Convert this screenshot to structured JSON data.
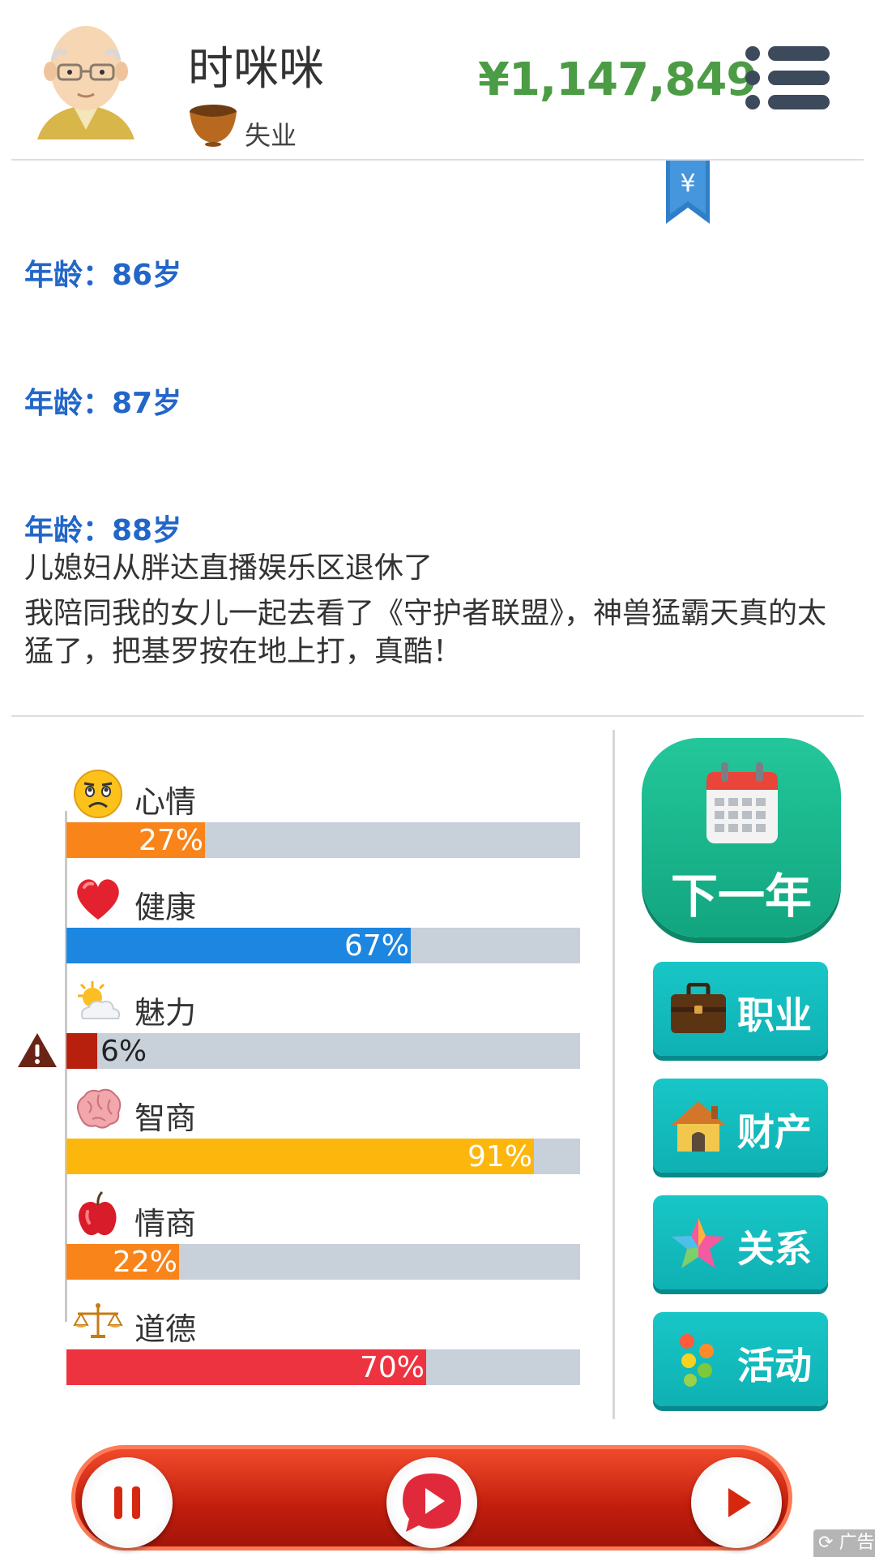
{
  "header": {
    "player_name": "时咪咪",
    "job": "失业",
    "money": "¥1,147,849"
  },
  "log": {
    "ages": [
      "年龄：86岁",
      "年龄：87岁",
      "年龄：88岁"
    ],
    "events": [
      "儿媳妇从胖达直播娱乐区退休了",
      "我陪同我的女儿一起去看了《守护者联盟》，神兽猛霸天真的太猛了，把基罗按在地上打，真酷！"
    ]
  },
  "stats": [
    {
      "label": "心情",
      "icon": "sad-face-icon",
      "value": 27,
      "text": "27%",
      "color": "#f8841a"
    },
    {
      "label": "健康",
      "icon": "heart-icon",
      "value": 67,
      "text": "67%",
      "color": "#1d86e0"
    },
    {
      "label": "魅力",
      "icon": "sun-cloud-icon",
      "value": 6,
      "text": "6%",
      "color": "#b8200e",
      "warning": true
    },
    {
      "label": "智商",
      "icon": "brain-icon",
      "value": 91,
      "text": "91%",
      "color": "#fdb60c"
    },
    {
      "label": "情商",
      "icon": "apple-icon",
      "value": 22,
      "text": "22%",
      "color": "#f8841a"
    },
    {
      "label": "道德",
      "icon": "scales-icon",
      "value": 70,
      "text": "70%",
      "color": "#ee3340"
    }
  ],
  "buttons": {
    "next_year": "下一年",
    "career": "职业",
    "assets": "财产",
    "relations": "关系",
    "activities": "活动"
  },
  "footer": {
    "ad_label": "广告"
  },
  "colors": {
    "money": "#4c9c45",
    "age_text": "#2266c8",
    "teal_button": "#14bcbd",
    "green_button": "#1ab88d",
    "bottom_bar": "#d6260f"
  }
}
